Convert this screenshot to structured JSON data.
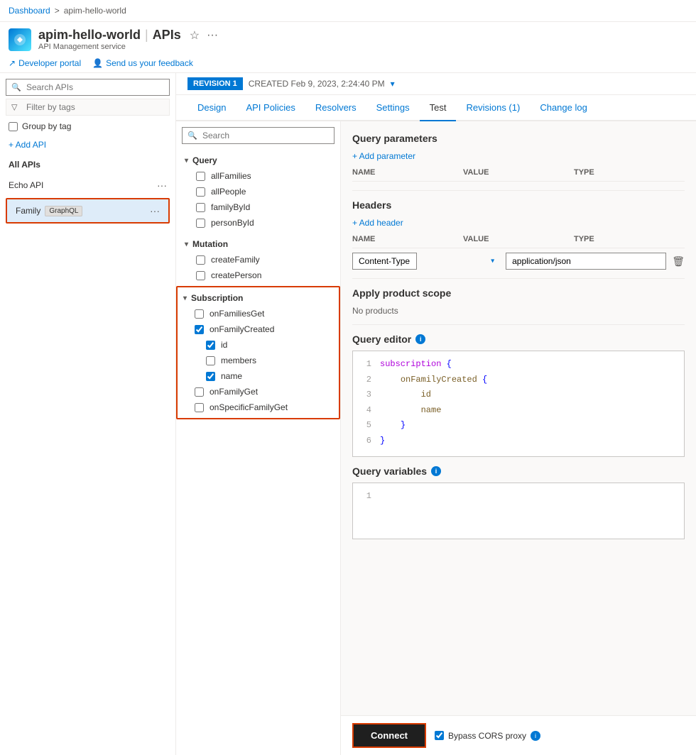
{
  "breadcrumb": {
    "dashboard": "Dashboard",
    "separator": ">",
    "current": "apim-hello-world"
  },
  "header": {
    "title": "apim-hello-world",
    "divider": "|",
    "section": "APIs",
    "subtitle": "API Management service",
    "star": "☆",
    "more": "···"
  },
  "toolbar": {
    "developer_portal": "Developer portal",
    "feedback": "Send us your feedback"
  },
  "sidebar": {
    "search_placeholder": "Search APIs",
    "filter_placeholder": "Filter by tags",
    "group_by_tag": "Group by tag",
    "add_api": "+ Add API",
    "all_apis": "All APIs",
    "apis": [
      {
        "name": "Echo API",
        "tag": null,
        "selected": false
      },
      {
        "name": "Family",
        "tag": "GraphQL",
        "selected": true
      }
    ]
  },
  "revision_bar": {
    "badge": "REVISION 1",
    "created": "CREATED Feb 9, 2023, 2:24:40 PM",
    "dropdown_icon": "▾"
  },
  "tabs": [
    {
      "label": "Design",
      "active": false
    },
    {
      "label": "API Policies",
      "active": false
    },
    {
      "label": "Resolvers",
      "active": false
    },
    {
      "label": "Settings",
      "active": false
    },
    {
      "label": "Test",
      "active": true
    },
    {
      "label": "Revisions (1)",
      "active": false
    },
    {
      "label": "Change log",
      "active": false
    }
  ],
  "operations": {
    "search_placeholder": "Search",
    "groups": [
      {
        "name": "Query",
        "items": [
          {
            "label": "allFamilies",
            "checked": false
          },
          {
            "label": "allPeople",
            "checked": false
          },
          {
            "label": "familyById",
            "checked": false
          },
          {
            "label": "personById",
            "checked": false
          }
        ]
      },
      {
        "name": "Mutation",
        "items": [
          {
            "label": "createFamily",
            "checked": false
          },
          {
            "label": "createPerson",
            "checked": false
          }
        ]
      },
      {
        "name": "Subscription",
        "items": [
          {
            "label": "onFamiliesGet",
            "checked": false
          },
          {
            "label": "onFamilyCreated",
            "checked": true,
            "children": [
              {
                "label": "id",
                "checked": true
              },
              {
                "label": "members",
                "checked": false
              },
              {
                "label": "name",
                "checked": true
              }
            ]
          },
          {
            "label": "onFamilyGet",
            "checked": false
          },
          {
            "label": "onSpecificFamilyGet",
            "checked": false
          }
        ]
      }
    ]
  },
  "right_panel": {
    "query_params": {
      "title": "Query parameters",
      "add_label": "+ Add parameter",
      "col_name": "NAME",
      "col_value": "VALUE",
      "col_type": "TYPE"
    },
    "headers": {
      "title": "Headers",
      "add_label": "+ Add header",
      "col_name": "NAME",
      "col_value": "VALUE",
      "col_type": "TYPE",
      "content_type_name": "Content-Type",
      "content_type_value": "application/json"
    },
    "product_scope": {
      "title": "Apply product scope",
      "no_products": "No products"
    },
    "query_editor": {
      "title": "Query editor",
      "lines": [
        {
          "num": "1",
          "content": "subscription {"
        },
        {
          "num": "2",
          "content": "    onFamilyCreated {"
        },
        {
          "num": "3",
          "content": "        id"
        },
        {
          "num": "4",
          "content": "        name"
        },
        {
          "num": "5",
          "content": "    }"
        },
        {
          "num": "6",
          "content": "}"
        }
      ]
    },
    "query_variables": {
      "title": "Query variables",
      "lines": [
        {
          "num": "1",
          "content": ""
        }
      ]
    }
  },
  "bottom_bar": {
    "connect_label": "Connect",
    "bypass_label": "Bypass CORS proxy"
  }
}
